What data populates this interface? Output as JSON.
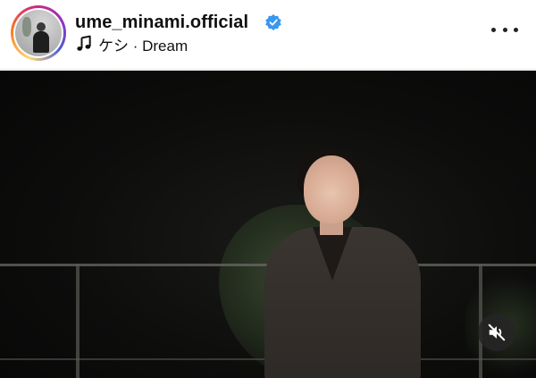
{
  "post_header": {
    "username": "ume_minami.official",
    "verified": true,
    "avatar_icon": "profile-avatar",
    "music": {
      "icon": "music-note-icon",
      "song_text": "ケシ · Dream"
    },
    "more_icon": "more-options-icon"
  },
  "media": {
    "type": "video",
    "audio_state": "muted",
    "mute_icon": "speaker-muted-icon"
  },
  "colors": {
    "verified_blue": "#3897f0",
    "text": "#111111",
    "story_ring": [
      "#feda75",
      "#fa7e1e",
      "#d62976",
      "#962fbf",
      "#4f5bd5"
    ]
  }
}
